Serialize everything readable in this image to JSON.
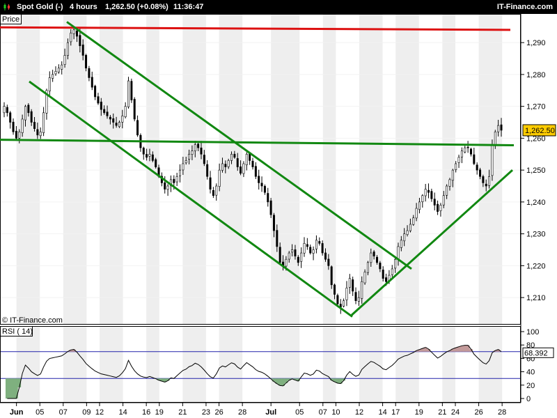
{
  "header": {
    "instrument": "Spot Gold (-)",
    "timeframe": "4 hours",
    "quote": "1,262.50 (+0.08%)",
    "time": "11:36:47",
    "brand": "IT-Finance.com",
    "icon": "candlestick-icon"
  },
  "price_panel": {
    "label": "Price",
    "watermark": "© IT-Finance.com"
  },
  "rsi_panel": {
    "label": "RSI ( 14)"
  },
  "colors": {
    "background": "#ffffff",
    "band": "#eeeeee",
    "trendline": "#118811",
    "resistance": "#dd1111",
    "price_tag": "#ffcc00",
    "rsi_line": "#000000",
    "rsi_level": "#2222aa",
    "rsi_overbought_fill": "#c39a9a",
    "rsi_oversold_fill": "#7fb07f"
  },
  "chart_data": [
    {
      "type": "candlestick",
      "title": "Spot Gold (-) 4 hours",
      "y_ticks": [
        "1,210",
        "1,220",
        "1,230",
        "1,240",
        "1,250",
        "1,260",
        "1,270",
        "1,280",
        "1,290"
      ],
      "ylim": [
        1201.5,
        1299
      ],
      "last_price": 1262.5,
      "last_price_label": "1,262.50",
      "x_labels": [
        {
          "text": "Jun",
          "bold": true,
          "t": 5
        },
        {
          "text": "05",
          "t": 14
        },
        {
          "text": "07",
          "t": 23
        },
        {
          "text": "09",
          "t": 32
        },
        {
          "text": "12",
          "t": 37
        },
        {
          "text": "14",
          "t": 46
        },
        {
          "text": "16",
          "t": 55
        },
        {
          "text": "19",
          "t": 60
        },
        {
          "text": "21",
          "t": 69
        },
        {
          "text": "23",
          "t": 78
        },
        {
          "text": "26",
          "t": 83
        },
        {
          "text": "28",
          "t": 92
        },
        {
          "text": "Jul",
          "bold": true,
          "t": 103
        },
        {
          "text": "05",
          "t": 114
        },
        {
          "text": "07",
          "t": 123
        },
        {
          "text": "10",
          "t": 128
        },
        {
          "text": "12",
          "t": 137
        },
        {
          "text": "14",
          "t": 146
        },
        {
          "text": "17",
          "t": 151
        },
        {
          "text": "19",
          "t": 160
        },
        {
          "text": "21",
          "t": 169
        },
        {
          "text": "24",
          "t": 174
        },
        {
          "text": "26",
          "t": 183
        },
        {
          "text": "28",
          "t": 192
        }
      ],
      "closes": [
        1270,
        1268,
        1265,
        1262,
        1260,
        1262,
        1266,
        1270,
        1268,
        1265,
        1263,
        1261,
        1262,
        1268,
        1275,
        1279,
        1280,
        1281,
        1282,
        1283,
        1286,
        1290,
        1293,
        1294,
        1292,
        1289,
        1286,
        1282,
        1279,
        1276,
        1273,
        1271,
        1269,
        1268,
        1267,
        1266,
        1265,
        1264,
        1265,
        1267,
        1270,
        1278,
        1272,
        1266,
        1261,
        1257,
        1255,
        1254,
        1255,
        1253,
        1251,
        1248,
        1246,
        1244,
        1245,
        1247,
        1246,
        1248,
        1250,
        1252,
        1253,
        1255,
        1256,
        1258,
        1257,
        1255,
        1252,
        1248,
        1244,
        1242,
        1245,
        1250,
        1252,
        1251,
        1253,
        1255,
        1254,
        1251,
        1249,
        1252,
        1255,
        1253,
        1251,
        1248,
        1246,
        1245,
        1243,
        1240,
        1236,
        1231,
        1226,
        1221,
        1220,
        1222,
        1224,
        1225,
        1223,
        1221,
        1224,
        1227,
        1226,
        1224,
        1225,
        1228,
        1227,
        1224,
        1222,
        1220,
        1214,
        1211,
        1208,
        1207,
        1209,
        1213,
        1216,
        1212,
        1209,
        1210,
        1215,
        1218,
        1221,
        1224,
        1223,
        1221,
        1219,
        1216,
        1215,
        1217,
        1219,
        1222,
        1226,
        1228,
        1230,
        1231,
        1233,
        1235,
        1238,
        1240,
        1242,
        1244,
        1243,
        1241,
        1239,
        1237,
        1239,
        1242,
        1245,
        1247,
        1250,
        1252,
        1254,
        1256,
        1257,
        1257,
        1255,
        1252,
        1250,
        1248,
        1246,
        1245,
        1248,
        1258,
        1262,
        1264,
        1262.5
      ],
      "rsi": {
        "ylim": [
          0,
          100
        ],
        "y_ticks": [
          "0",
          "20",
          "40",
          "60",
          "80",
          "100"
        ],
        "levels": [
          30,
          70
        ],
        "last_value": 68.392,
        "last_value_label": "68.392"
      }
    }
  ]
}
